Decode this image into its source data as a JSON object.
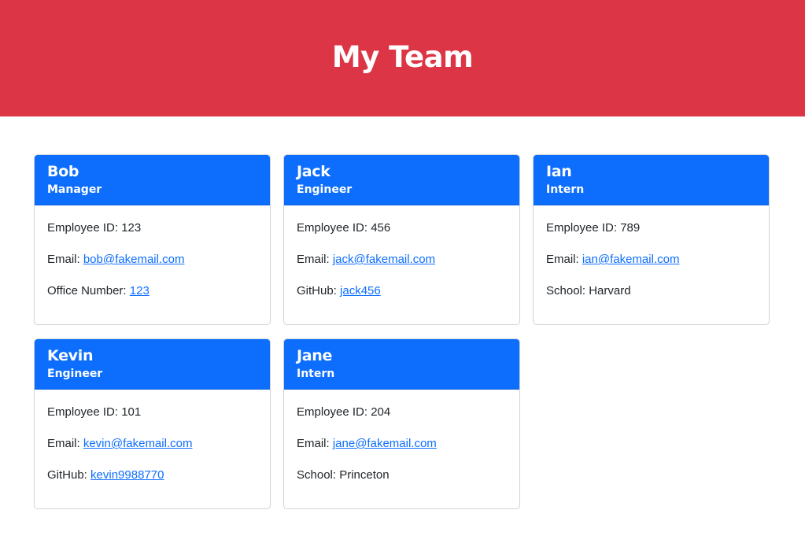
{
  "header": {
    "title": "My Team"
  },
  "colors": {
    "header_bg": "#dc3545",
    "card_head_bg": "#0d6efd",
    "link": "#0d6efd"
  },
  "cards": [
    {
      "name": "Bob",
      "role": "Manager",
      "id_label": "Employee ID: ",
      "id_value": "123",
      "email_label": "Email: ",
      "email": "bob@fakemail.com",
      "extra_label": "Office Number: ",
      "extra_value": "123"
    },
    {
      "name": "Jack",
      "role": "Engineer",
      "id_label": "Employee ID: ",
      "id_value": "456",
      "email_label": "Email: ",
      "email": "jack@fakemail.com",
      "extra_label": "GitHub: ",
      "extra_value": "jack456"
    },
    {
      "name": "Ian",
      "role": "Intern",
      "id_label": "Employee ID: ",
      "id_value": "789",
      "email_label": "Email: ",
      "email": "ian@fakemail.com",
      "extra_label": "School: ",
      "extra_value": "Harvard"
    },
    {
      "name": "Kevin",
      "role": "Engineer",
      "id_label": "Employee ID: ",
      "id_value": "101",
      "email_label": "Email: ",
      "email": "kevin@fakemail.com",
      "extra_label": "GitHub: ",
      "extra_value": "kevin9988770"
    },
    {
      "name": "Jane",
      "role": "Intern",
      "id_label": "Employee ID: ",
      "id_value": "204",
      "email_label": "Email: ",
      "email": "jane@fakemail.com",
      "extra_label": "School: ",
      "extra_value": "Princeton"
    }
  ]
}
